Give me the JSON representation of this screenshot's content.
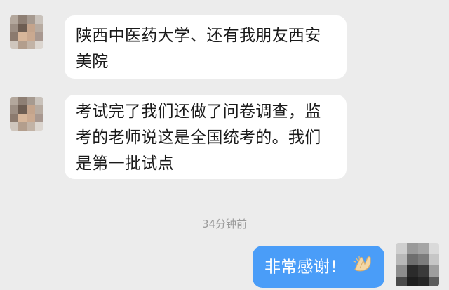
{
  "messages": [
    {
      "sender": "other",
      "lines": [
        "陕西中医药大学、还有我朋友西安",
        "美院"
      ]
    },
    {
      "sender": "other",
      "lines": [
        "考试完了我们还做了问卷调查，监",
        "考的老师说这是全国统考的。我们",
        "是第一批试点"
      ]
    },
    {
      "sender": "self",
      "lines": [
        "非常感谢！"
      ],
      "emoji": "clapping-hands-icon"
    }
  ],
  "timestamp": "34分钟前",
  "colors": {
    "background": "#ececec",
    "incoming_bubble": "#ffffff",
    "outgoing_bubble": "#4a9df8",
    "timestamp_text": "#9a9a9a"
  }
}
